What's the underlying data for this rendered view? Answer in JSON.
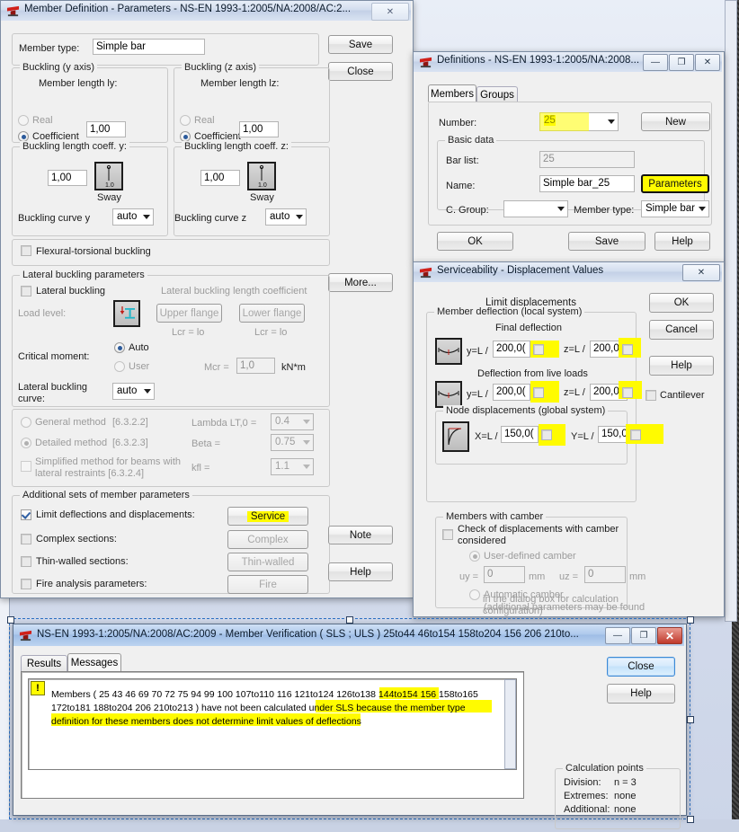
{
  "desktop": {
    "bg_color": "#d6dded"
  },
  "member_params": {
    "title": "Member Definition - Parameters - NS-EN 1993-1:2005/NA:2008/AC:2...",
    "close_glyph": "✕",
    "member_type_label": "Member type:",
    "member_type_value": "Simple bar",
    "save_button": "Save",
    "close_button": "Close",
    "buckling_y": {
      "group": "Buckling (y axis)",
      "length_label": "Member length ly:",
      "real_label": "Real",
      "coefficient_label": "Coefficient",
      "coefficient_value": "1,00",
      "coeff_group": "Buckling length coeff. y:",
      "coeff_value": "1,00",
      "sway_label": "Sway",
      "sway_icon_value": "1.0",
      "curve_label": "Buckling curve y",
      "curve_value": "auto"
    },
    "buckling_z": {
      "group": "Buckling (z axis)",
      "length_label": "Member length lz:",
      "real_label": "Real",
      "coefficient_label": "Coefficient",
      "coefficient_value": "1,00",
      "coeff_group": "Buckling length coeff. z:",
      "coeff_value": "1,00",
      "sway_label": "Sway",
      "sway_icon_value": "1.0",
      "curve_label": "Buckling curve z",
      "curve_value": "auto"
    },
    "flexural_torsional_label": "Flexural-torsional buckling",
    "more_button": "More...",
    "lateral": {
      "group": "Lateral buckling parameters",
      "lateral_buckling_label": "Lateral buckling",
      "length_coeff_label": "Lateral buckling length coefficient",
      "load_level_label": "Load level:",
      "upper_flange_button": "Upper flange",
      "lower_flange_button": "Lower flange",
      "lcr_upper": "Lcr =  lo",
      "lcr_lower": "Lcr =  lo",
      "critical_moment_label": "Critical moment:",
      "auto_label": "Auto",
      "user_label": "User",
      "mcr_label": "Mcr =",
      "mcr_value": "1,0",
      "mcr_unit": "kN*m",
      "curve_label_1": "Lateral buckling",
      "curve_label_2": "curve:",
      "curve_value": "auto"
    },
    "methods": {
      "general_label": "General method",
      "general_ref": "[6.3.2.2]",
      "detailed_label": "Detailed method",
      "detailed_ref": "[6.3.2.3]",
      "simplified_label_1": "Simplified method for beams with",
      "simplified_label_2": "lateral restraints [6.3.2.4]",
      "lambda_label": "Lambda LT,0 =",
      "lambda_value": "0.4",
      "beta_label": "Beta =",
      "beta_value": "0.75",
      "kfl_label": "kfl =",
      "kfl_value": "1.1"
    },
    "additional": {
      "group": "Additional sets of member parameters",
      "limit_label": "Limit deflections and displacements:",
      "service_button": "Service",
      "complex_label": "Complex sections:",
      "complex_button": "Complex",
      "thin_label": "Thin-walled sections:",
      "thin_button": "Thin-walled",
      "fire_label": "Fire analysis parameters:",
      "fire_button": "Fire",
      "note_button": "Note",
      "help_button": "Help"
    }
  },
  "definitions": {
    "title": "Definitions - NS-EN 1993-1:2005/NA:2008...",
    "min_glyph": "—",
    "max_glyph": "❐",
    "close_glyph": "✕",
    "tabs": [
      {
        "label": "Members",
        "selected": true
      },
      {
        "label": "Groups",
        "selected": false
      }
    ],
    "number_label": "Number:",
    "number_value": "25",
    "new_button": "New",
    "basic_data_group": "Basic data",
    "bar_list_label": "Bar list:",
    "bar_list_value": "25",
    "name_label": "Name:",
    "name_value": "Simple bar_25",
    "parameters_button": "Parameters",
    "cgroup_label": "C. Group:",
    "cgroup_value": "",
    "member_type_label": "Member type:",
    "member_type_value": "Simple bar",
    "ok_button": "OK",
    "save_button": "Save",
    "help_button": "Help"
  },
  "serviceability": {
    "title": "Serviceability - Displacement Values",
    "close_glyph": "✕",
    "limit_displacements_label": "Limit displacements",
    "member_deflection_group": "Member deflection (local system)",
    "final_deflection_label": "Final deflection",
    "final": {
      "y_label": "y=L /",
      "y_value": "200,0(",
      "z_label": "z=L /",
      "z_value": "200,0("
    },
    "live_loads_label": "Deflection from live loads",
    "live": {
      "y_label": "y=L /",
      "y_value": "200,0(",
      "z_label": "z=L /",
      "z_value": "200,0("
    },
    "node_group": "Node displacements (global system)",
    "node": {
      "x_label": "X=L /",
      "x_value": "150,0(",
      "y_label": "Y=L /",
      "y_value": "150,0("
    },
    "cantilever_label": "Cantilever",
    "camber_group": "Members with camber",
    "camber_check_1": "Check of displacements with camber",
    "camber_check_2": "considered",
    "user_camber_label": "User-defined camber",
    "uy_label": "uy =",
    "uy_value": "0",
    "uy_unit": "mm",
    "uz_label": "uz =",
    "uz_value": "0",
    "uz_unit": "mm",
    "auto_camber_label": "Automatic camber",
    "auto_note_1": "(additional parameters may be found",
    "auto_note_2": "in the dialog box for calculation",
    "auto_note_3": "configuration)",
    "ok_button": "OK",
    "cancel_button": "Cancel",
    "help_button": "Help"
  },
  "verification": {
    "title": "NS-EN 1993-1:2005/NA:2008/AC:2009 - Member Verification ( SLS ; ULS ) 25to44 46to154 158to204 156 206 210to...",
    "min_glyph": "—",
    "max_glyph": "❐",
    "close_glyph": "✕",
    "tabs": [
      {
        "label": "Results",
        "selected": false
      },
      {
        "label": "Messages",
        "selected": true
      }
    ],
    "warning_glyph": "!",
    "message_lines": [
      "Members (  25 43 46 69 70 72 75 94 99 100 107to110 116 121to124 126to138 144to154 156   158to165",
      "172to181 188to204 206 210to213   ) have not been calculated under SLS because the member type",
      "definition for these members does not determine limit values of deflections"
    ],
    "close_button": "Close",
    "help_button": "Help",
    "calc_points_group": "Calculation points",
    "calc_rows": [
      {
        "label": "Division:",
        "value": "n = 3"
      },
      {
        "label": "Extremes:",
        "value": "none"
      },
      {
        "label": "Additional:",
        "value": "none"
      }
    ]
  }
}
